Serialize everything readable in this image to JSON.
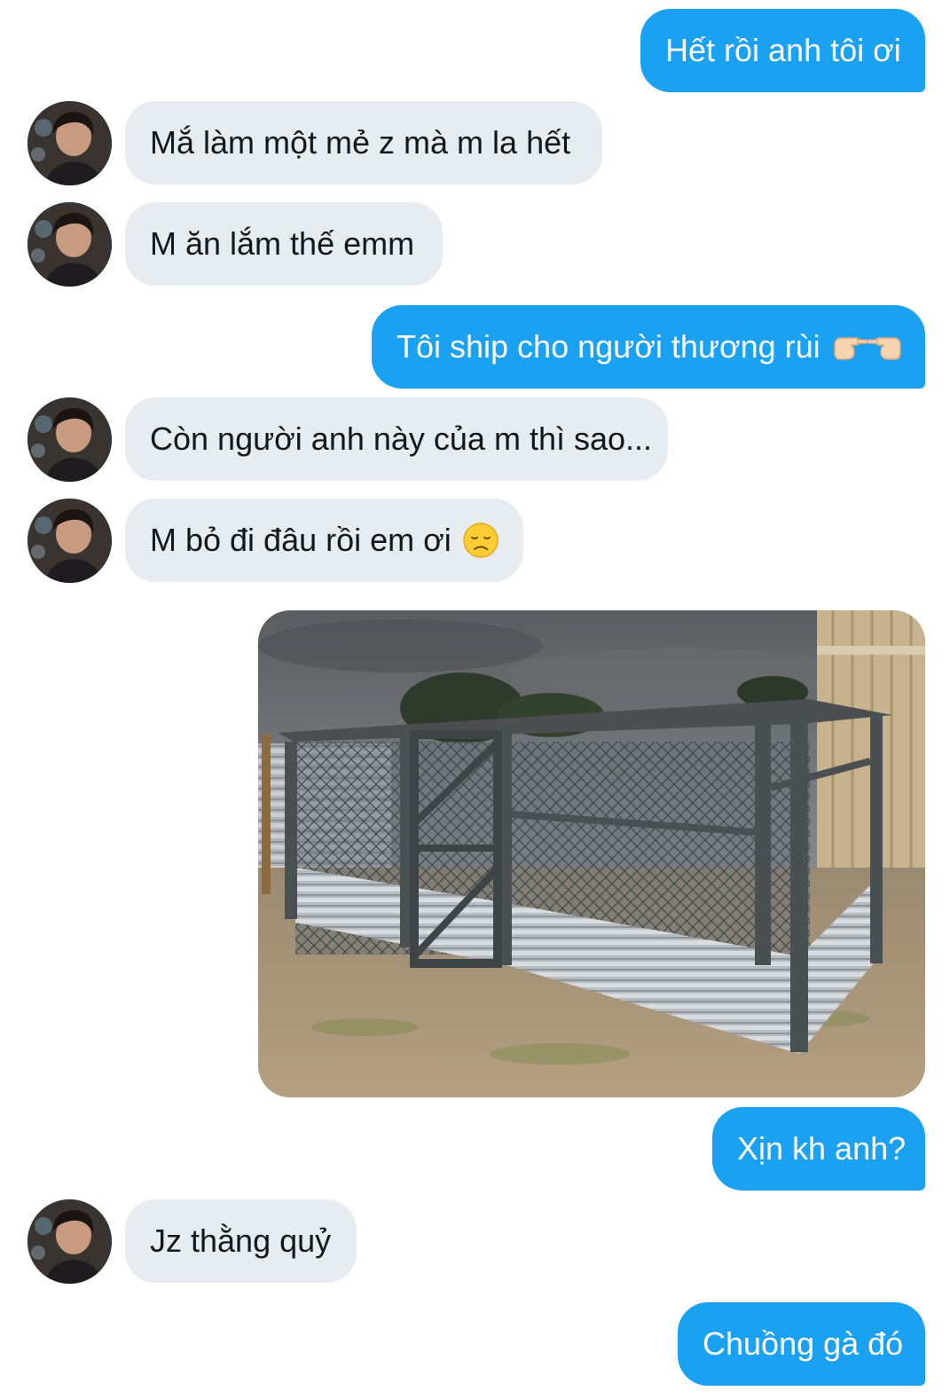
{
  "messages": [
    {
      "side": "out",
      "text": "Hết rồi anh tôi ơi"
    },
    {
      "side": "in",
      "text": "Mắ làm một mẻ z mà m la hết"
    },
    {
      "side": "in",
      "text": "M ăn lắm thế emm"
    },
    {
      "side": "out",
      "text": "Tôi ship cho người thương rùi",
      "emoji": "pointing-hands-icon"
    },
    {
      "side": "in",
      "text": "Còn người anh này của m thì sao..."
    },
    {
      "side": "in",
      "text": "M bỏ đi đâu rồi em ơi",
      "emoji": "disappointed-face-icon"
    },
    {
      "side": "out",
      "type": "image",
      "content": "chicken-coop-photo"
    },
    {
      "side": "out",
      "text": "Xịn kh anh?"
    },
    {
      "side": "in",
      "text": "Jz thằng quỷ"
    },
    {
      "side": "out",
      "text": "Chuồng gà đó"
    }
  ],
  "colors": {
    "outgoing_bubble": "#1ba1f2",
    "incoming_bubble": "#e6ecf0",
    "outgoing_text": "#ffffff",
    "incoming_text": "#14171a"
  }
}
